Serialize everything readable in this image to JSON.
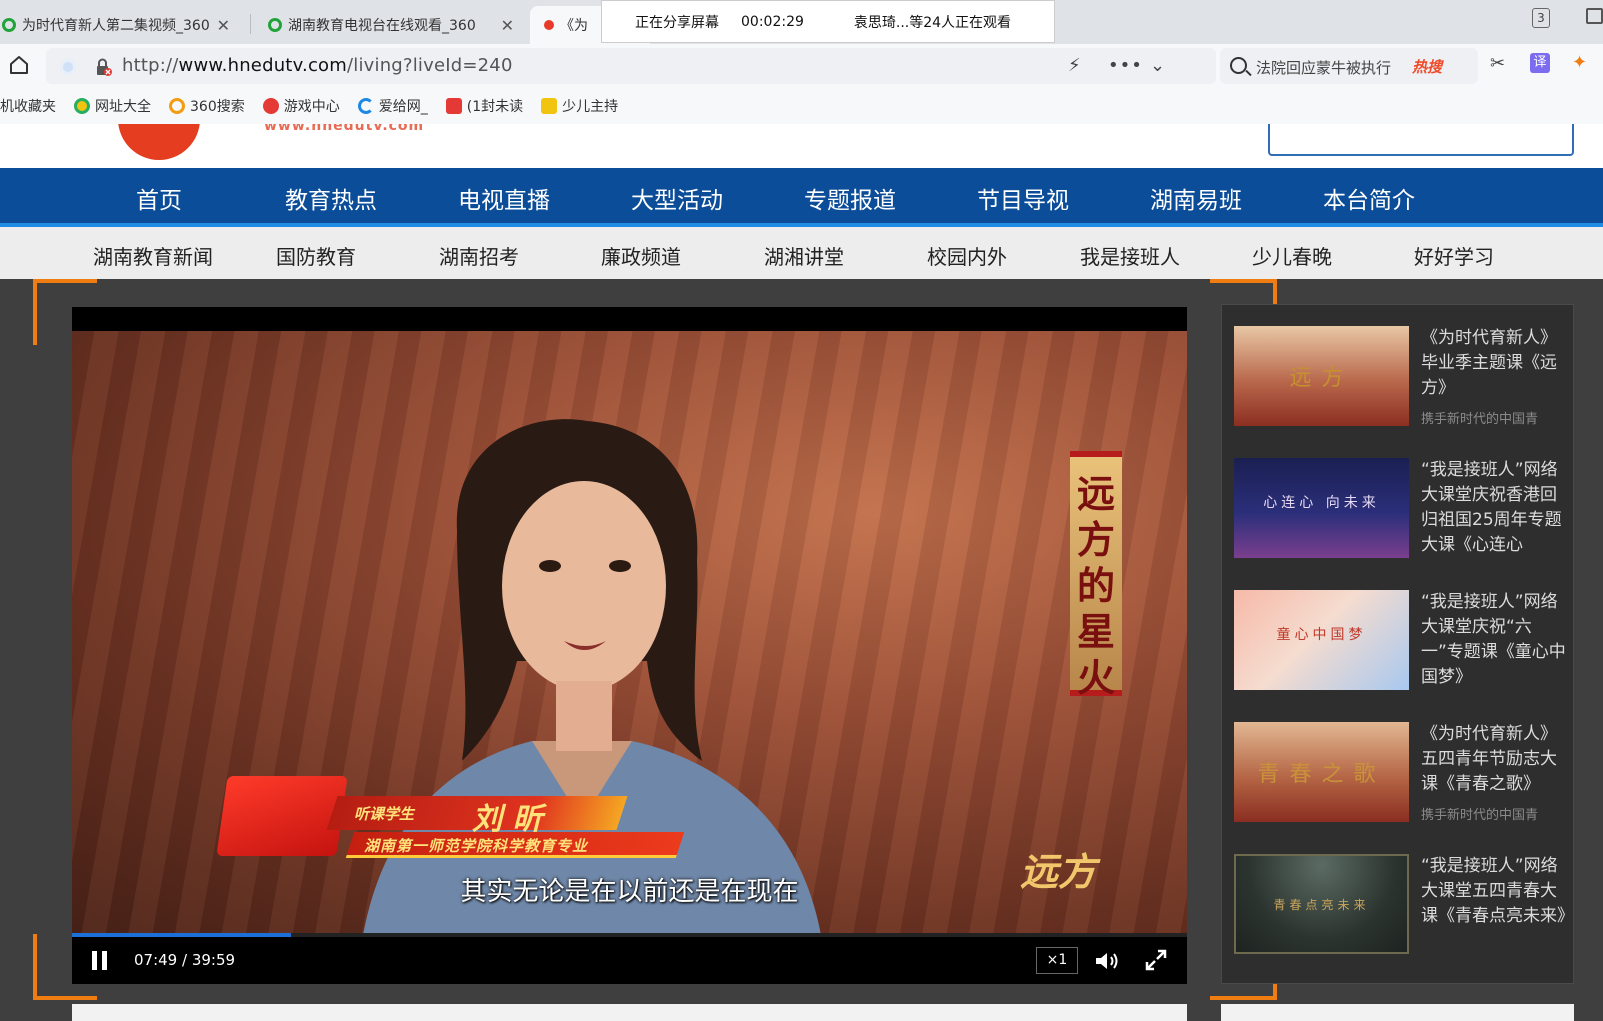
{
  "browser": {
    "tabs": [
      {
        "title": "为时代育新人第二集视频_360"
      },
      {
        "title": "湖南教育电视台在线观看_360"
      },
      {
        "title": "《为"
      }
    ],
    "share_status": {
      "label": "正在分享屏幕",
      "elapsed": "00:02:29",
      "viewers": "袁思琦...等24人正在观看"
    },
    "tab_count": "3",
    "url_prefix": "http://",
    "url_host": "www.hnedutv.com",
    "url_path": "/living?liveId=240",
    "search_text": "法院回应蒙牛被执行",
    "search_badge": "热搜",
    "bookmarks": [
      "机收藏夹",
      "网址大全",
      "360搜索",
      "游戏中心",
      "爱给网_",
      "(1封未读",
      "少儿主持"
    ]
  },
  "site": {
    "logo_url": "www.hnedutv.com",
    "main_nav": [
      "首页",
      "教育热点",
      "电视直播",
      "大型活动",
      "专题报道",
      "节目导视",
      "湖南易班",
      "本台简介"
    ],
    "sub_nav": [
      "湖南教育新闻",
      "国防教育",
      "湖南招考",
      "廉政频道",
      "湖湘讲堂",
      "校园内外",
      "我是接班人",
      "少儿春晚",
      "好好学习"
    ]
  },
  "player": {
    "overlay_title": "远方的星火",
    "overlay_sign": "远方",
    "lower_third_role": "听课学生",
    "lower_third_name": "刘 昕",
    "lower_third_school": "湖南第一师范学院科学教育专业",
    "subtitle": "其实无论是在以前还是在现在",
    "current_time": "07:49",
    "duration": "39:59",
    "progress": 0.196,
    "speed": "×1"
  },
  "playlist": [
    {
      "title": "《为时代育新人》毕业季主题课《远方》",
      "sub": "携手新时代的中国青",
      "thumb_text": "远方",
      "thumb_bg": "linear-gradient(180deg,#e8c7a5 0%,#b9684c 55%,#8c2f22 100%)",
      "thumb_color": "#c7902f"
    },
    {
      "title": "“我是接班人”网络大课堂庆祝香港回归祖国25周年专题大课《心连心",
      "sub": "",
      "thumb_text": "心连心 向未来",
      "thumb_bg": "linear-gradient(180deg,#1a1f52 0%,#2b2f7a 55%,#7a3f8e 100%)",
      "thumb_color": "#e7d9f3"
    },
    {
      "title": "“我是接班人”网络大课堂庆祝“六一”专题课《童心中国梦》",
      "sub": "",
      "thumb_text": "童心中国梦",
      "thumb_bg": "linear-gradient(135deg,#f6b9a8 0%,#f5dccf 45%,#a8c8ef 100%)",
      "thumb_color": "#c0392b"
    },
    {
      "title": "《为时代育新人》五四青年节励志大课《青春之歌》",
      "sub": "携手新时代的中国青",
      "thumb_text": "青春之歌",
      "thumb_bg": "linear-gradient(180deg,#e2b793 0%,#b56645 55%,#8a2e22 100%)",
      "thumb_color": "#c9923a"
    },
    {
      "title": "“我是接班人”网络大课堂五四青春大课《青春点亮未来》",
      "sub": "",
      "thumb_text": "青春点亮未来",
      "thumb_bg": "radial-gradient(ellipse at 50% 10%,#5b6b63 0%,#2c3430 60%,#1d2320 100%)",
      "thumb_color": "#c9a45a"
    }
  ],
  "colors": {
    "nav_blue": "#0b4d98",
    "nav_underline": "#1f8de6",
    "accent_orange": "#f07d12",
    "progress_blue": "#1b6fd6",
    "hot_red": "#f04b2a"
  }
}
